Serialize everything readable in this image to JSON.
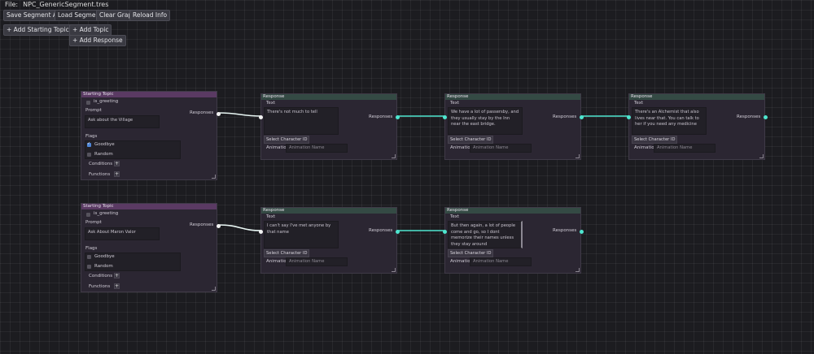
{
  "file": {
    "label": "File:",
    "name": "NPC_GenericSegment.tres"
  },
  "toolbar": {
    "save": "Save Segment As...",
    "load": "Load  Segment",
    "clear": "Clear Graph",
    "reload": "Reload Info"
  },
  "adds": {
    "starting_topic": "+ Add Starting Topic",
    "topic": "+ Add Topic",
    "response": "+ Add Response"
  },
  "common": {
    "starting_topic_title": "Starting Topic",
    "response_title": "Response",
    "is_greeting": "is_greeting",
    "prompt": "Prompt",
    "flags": "Flags",
    "goodbye": "Goodbye",
    "random": "Random",
    "conditions": "Conditions",
    "functions": "Functions",
    "responses": "Responses",
    "text": "Text",
    "select_character": "Select Character ID",
    "animation": "Animation",
    "animation_placeholder": "Animation Name",
    "plus": "+"
  },
  "topics": [
    {
      "prompt": "Ask about the Village",
      "goodbye_checked": true,
      "random_checked": false
    },
    {
      "prompt": "Ask About Maron Valor",
      "goodbye_checked": false,
      "random_checked": false
    }
  ],
  "responses": [
    {
      "text": "There's not much to tell"
    },
    {
      "text": "We have a lot of passersby, and they usually stay by the Inn near the east bridge."
    },
    {
      "text": "There's an Alchemist that also lives near that. You can talk to her if you need any medicine"
    },
    {
      "text": "I can't say I've met anyone by that name"
    },
    {
      "text": "But then again, a lot of people come and go, so I dont memorize their names unless they stay around"
    }
  ],
  "colors": {
    "wire": "#4ee6cf",
    "start_header": "#5a3a63",
    "response_header": "#344a44"
  }
}
